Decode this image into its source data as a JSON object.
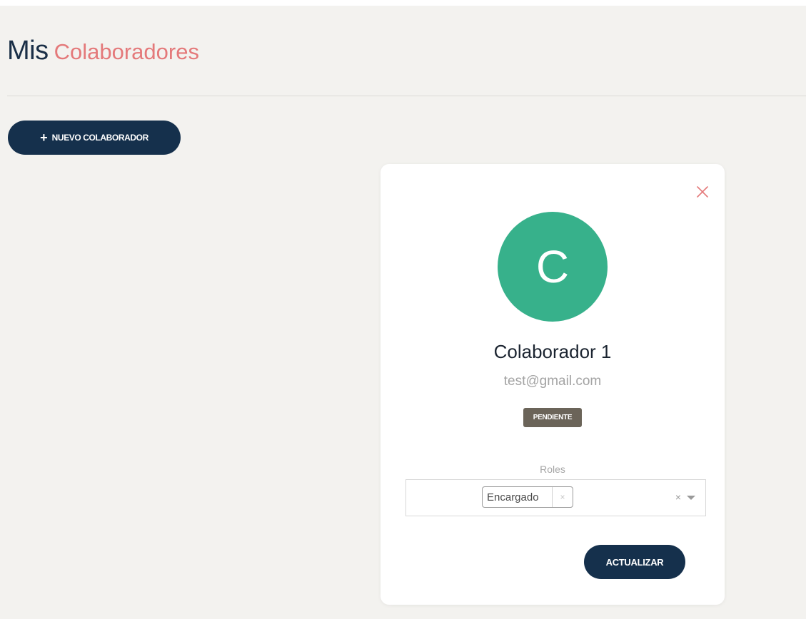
{
  "header": {
    "title_part1": "Mis",
    "title_part2": "Colaboradores"
  },
  "toolbar": {
    "new_icon": "plus-icon",
    "new_label": "NUEVO COLABORADOR"
  },
  "card": {
    "close_icon": "close-icon",
    "avatar_letter": "C",
    "name": "Colaborador 1",
    "email": "test@gmail.com",
    "status": "PENDIENTE",
    "roles_label": "Roles",
    "roles_selected": [
      "Encargado"
    ],
    "chip_remove_icon": "×",
    "clear_icon": "×",
    "update_label": "ACTUALIZAR"
  },
  "colors": {
    "background": "#f3f2ef",
    "primary": "#15304c",
    "accent": "#e4797a",
    "avatar": "#37b18b",
    "badge": "#6b6459"
  }
}
